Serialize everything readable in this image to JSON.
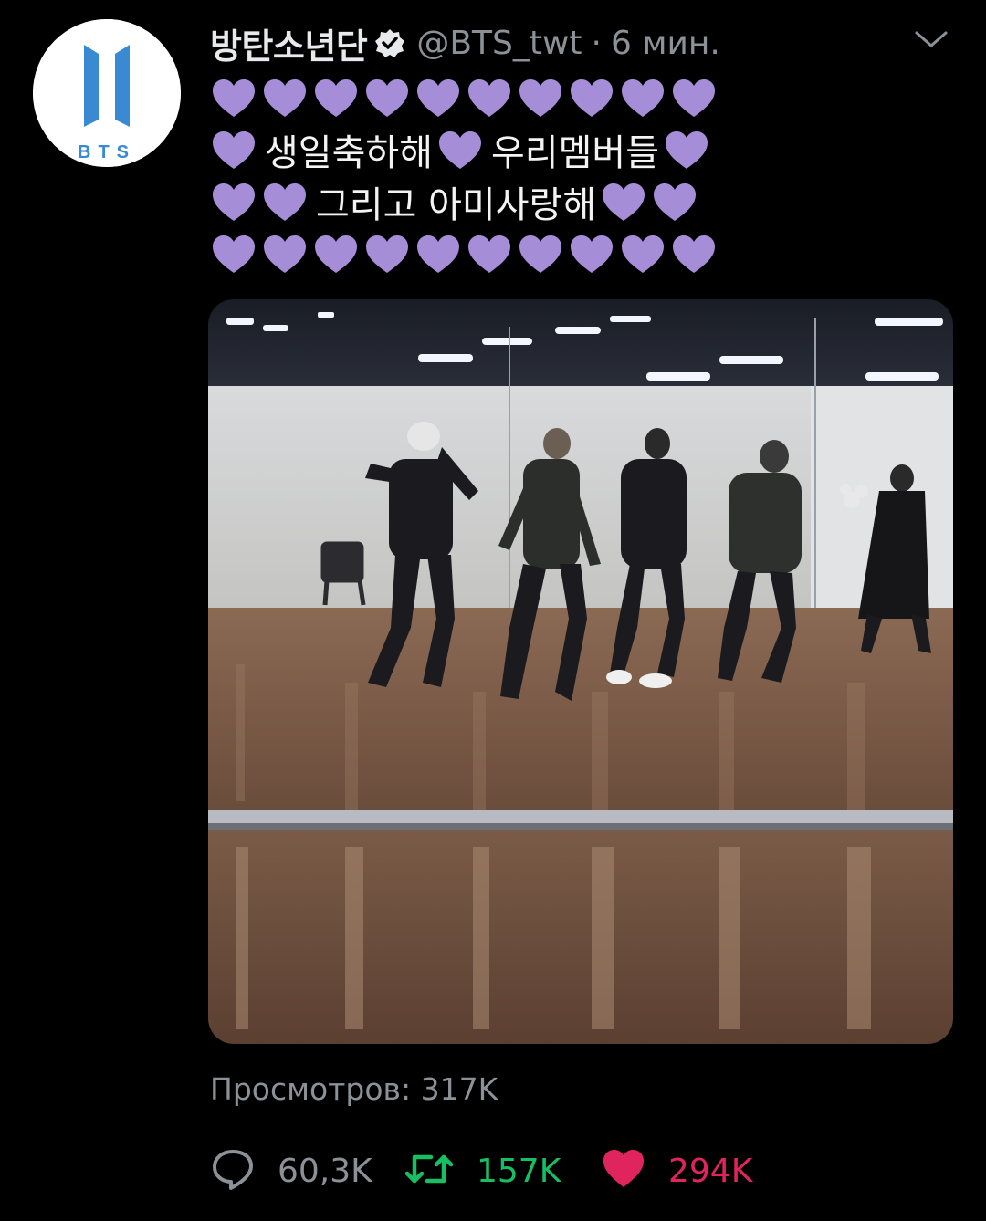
{
  "tweet": {
    "author": {
      "display_name": "방탄소년단",
      "handle": "@BTS_twt",
      "verified_icon": "verified-badge-icon",
      "avatar_logo_text": "BTS"
    },
    "separator": "·",
    "time": "6 мин.",
    "menu_icon": "chevron-down-icon",
    "text_lines": [
      {
        "hearts_before": 10,
        "text": "",
        "hearts_after": 0
      },
      {
        "hearts_before": 1,
        "text": "생일축하해",
        "hearts_mid": 1,
        "text2": "우리멤버들",
        "hearts_after": 1
      },
      {
        "hearts_before": 2,
        "text": "그리고 아미사랑해",
        "hearts_after": 2
      },
      {
        "hearts_before": 10,
        "text": "",
        "hearts_after": 0
      }
    ],
    "line2_text_a": "생일축하해",
    "line2_text_b": "우리멤버들",
    "line3_text": "그리고 아미사랑해",
    "heart_emoji_color": "#a58ed7",
    "views": "Просмотров: 317K",
    "actions": {
      "reply": {
        "icon": "reply-icon",
        "count": "60,3K"
      },
      "retweet": {
        "icon": "retweet-icon",
        "count": "157K",
        "color": "#17bf63"
      },
      "like": {
        "icon": "heart-icon",
        "count": "294K",
        "color": "#e0245e"
      }
    }
  },
  "colors": {
    "background": "#000000",
    "secondary_text": "#8b9197",
    "logo_blue": "#3a8ad3"
  }
}
